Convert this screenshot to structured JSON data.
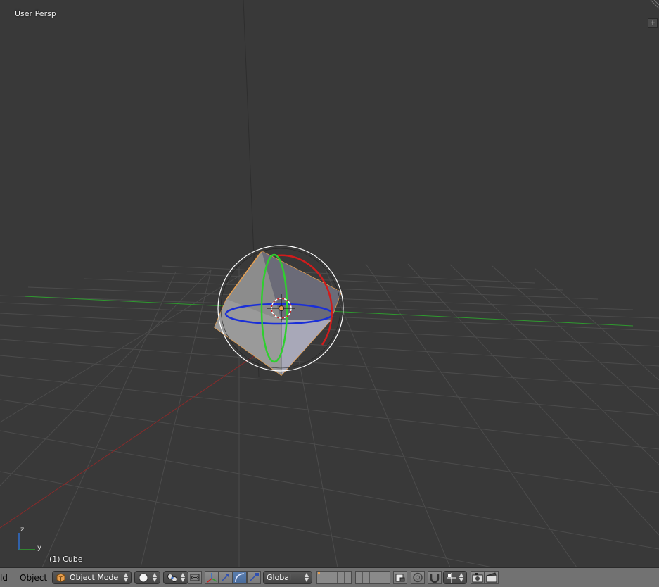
{
  "viewport": {
    "view_name": "User Persp",
    "object_name": "(1) Cube",
    "axis_labels": {
      "z": "z",
      "y": "y"
    }
  },
  "header": {
    "menu_cut": "ld",
    "menu_object": "Object",
    "mode": "Object Mode",
    "orientation": "Global"
  },
  "icons": {
    "mode": "cube-icon",
    "shading": "sphere-icon",
    "pivot": "pivot-icon",
    "manipulator": "manipulator-icon",
    "translate": "translate-icon",
    "rotate": "rotate-icon",
    "scale": "scale-icon",
    "render": "camera-icon",
    "animation": "clapper-icon"
  },
  "colors": {
    "background": "#393939",
    "axis_x": "#b03030",
    "axis_y": "#2f9a2f",
    "gizmo_blue": "#1a2fd8",
    "selection": "#e8a050",
    "header": "#727272",
    "active": "#5b7fb0"
  }
}
